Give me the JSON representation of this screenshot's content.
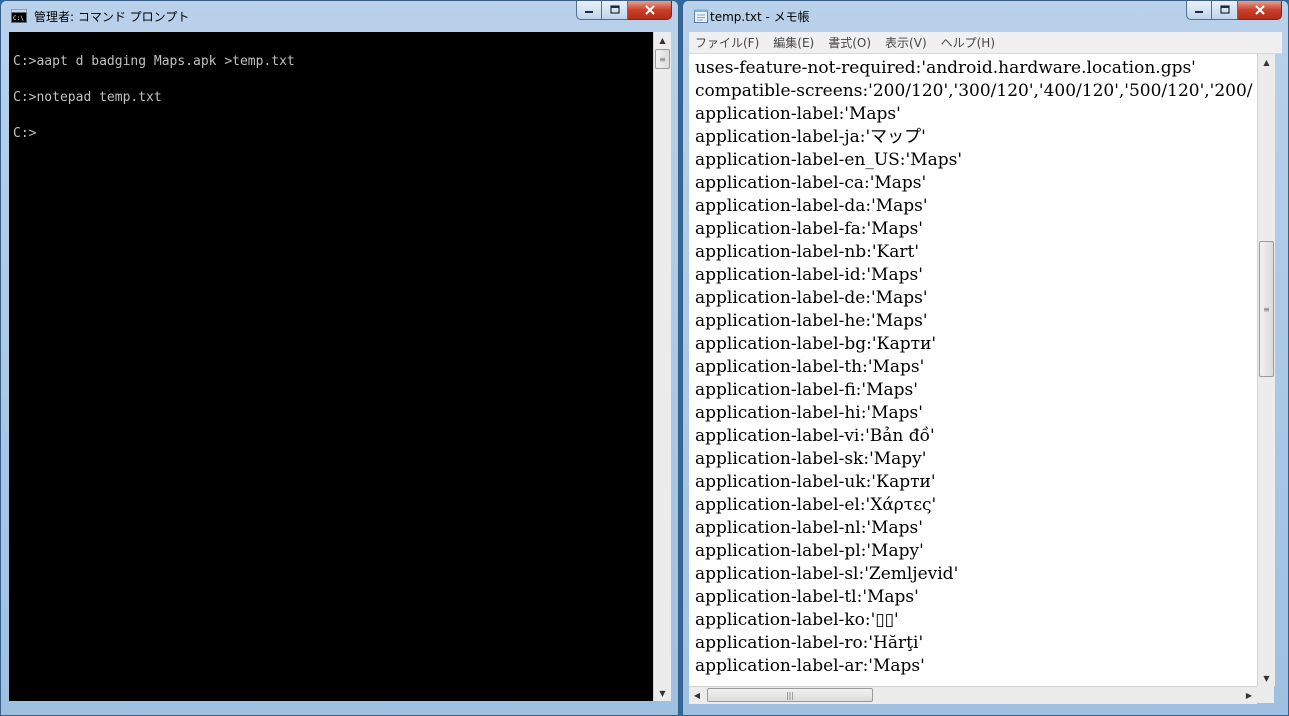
{
  "cmd": {
    "title": "管理者: コマンド プロンプト",
    "lines": [
      "C:>aapt d badging Maps.apk >temp.txt",
      "C:>notepad temp.txt",
      "C:>"
    ],
    "colors": {
      "background": "#000000",
      "text": "#c0c0c0"
    }
  },
  "notepad": {
    "title": "temp.txt - メモ帳",
    "menu": [
      "ファイル(F)",
      "編集(E)",
      "書式(O)",
      "表示(V)",
      "ヘルプ(H)"
    ],
    "lines": [
      "uses-feature-not-required:'android.hardware.location.gps'",
      "compatible-screens:'200/120','300/120','400/120','500/120','200/",
      "application-label:'Maps'",
      "application-label-ja:'マップ'",
      "application-label-en_US:'Maps'",
      "application-label-ca:'Maps'",
      "application-label-da:'Maps'",
      "application-label-fa:'Maps'",
      "application-label-nb:'Kart'",
      "application-label-id:'Maps'",
      "application-label-de:'Maps'",
      "application-label-he:'Maps'",
      "application-label-bg:'Карти'",
      "application-label-th:'Maps'",
      "application-label-fi:'Maps'",
      "application-label-hi:'Maps'",
      "application-label-vi:'Bản đồ'",
      "application-label-sk:'Mapy'",
      "application-label-uk:'Карти'",
      "application-label-el:'Χάρτες'",
      "application-label-nl:'Maps'",
      "application-label-pl:'Mapy'",
      "application-label-sl:'Zemljevid'",
      "application-label-tl:'Maps'",
      "application-label-ko:'▯▯'",
      "application-label-ro:'Hărţi'",
      "application-label-ar:'Maps'"
    ]
  },
  "icons": {
    "minimize": "minimize-icon",
    "maximize": "maximize-icon",
    "close": "close-icon"
  }
}
